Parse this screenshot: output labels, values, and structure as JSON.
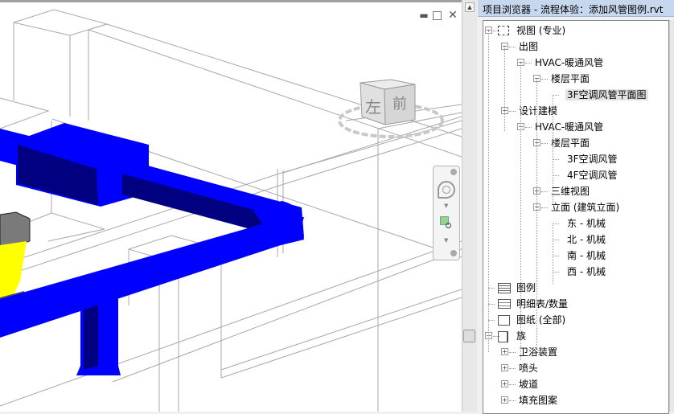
{
  "viewport": {
    "viewcube": {
      "left_face": "左",
      "front_face": "前"
    },
    "window_controls": [
      "minimize",
      "restore",
      "close"
    ],
    "colors": {
      "duct": "#0000ff",
      "duct_dark": "#000080",
      "equipment": "#ffff00",
      "wire": "#a8a8a8"
    }
  },
  "browser": {
    "title": "项目浏览器 - 流程体验：添加风管图例.rvt",
    "tree": [
      {
        "label": "视图 (专业)",
        "level": 0,
        "exp": "-",
        "icon": "views-icon"
      },
      {
        "label": "出图",
        "level": 1,
        "exp": "-"
      },
      {
        "label": "HVAC-暖通风管",
        "level": 2,
        "exp": "-"
      },
      {
        "label": "楼层平面",
        "level": 3,
        "exp": "-"
      },
      {
        "label": "3F空调风管平面图",
        "level": 4,
        "selected": true
      },
      {
        "label": "设计建模",
        "level": 1,
        "exp": "-"
      },
      {
        "label": "HVAC-暖通风管",
        "level": 2,
        "exp": "-"
      },
      {
        "label": "楼层平面",
        "level": 3,
        "exp": "-"
      },
      {
        "label": "3F空调风管",
        "level": 4
      },
      {
        "label": "4F空调风管",
        "level": 4
      },
      {
        "label": "三维视图",
        "level": 3,
        "exp": "+"
      },
      {
        "label": "立面 (建筑立面)",
        "level": 3,
        "exp": "-"
      },
      {
        "label": "东 - 机械",
        "level": 4
      },
      {
        "label": "北 - 机械",
        "level": 4
      },
      {
        "label": "南 - 机械",
        "level": 4
      },
      {
        "label": "西 - 机械",
        "level": 4
      },
      {
        "label": "图例",
        "level": 0,
        "icon": "legend-icon"
      },
      {
        "label": "明细表/数量",
        "level": 0,
        "icon": "schedule-icon"
      },
      {
        "label": "图纸 (全部)",
        "level": 0,
        "icon": "sheet-icon"
      },
      {
        "label": "族",
        "level": 0,
        "exp": "-",
        "icon": "family-icon"
      },
      {
        "label": "卫浴装置",
        "level": 1,
        "exp": "+"
      },
      {
        "label": "喷头",
        "level": 1,
        "exp": "+"
      },
      {
        "label": "坡道",
        "level": 1,
        "exp": "+"
      },
      {
        "label": "填充图案",
        "level": 1,
        "exp": "+"
      }
    ]
  }
}
